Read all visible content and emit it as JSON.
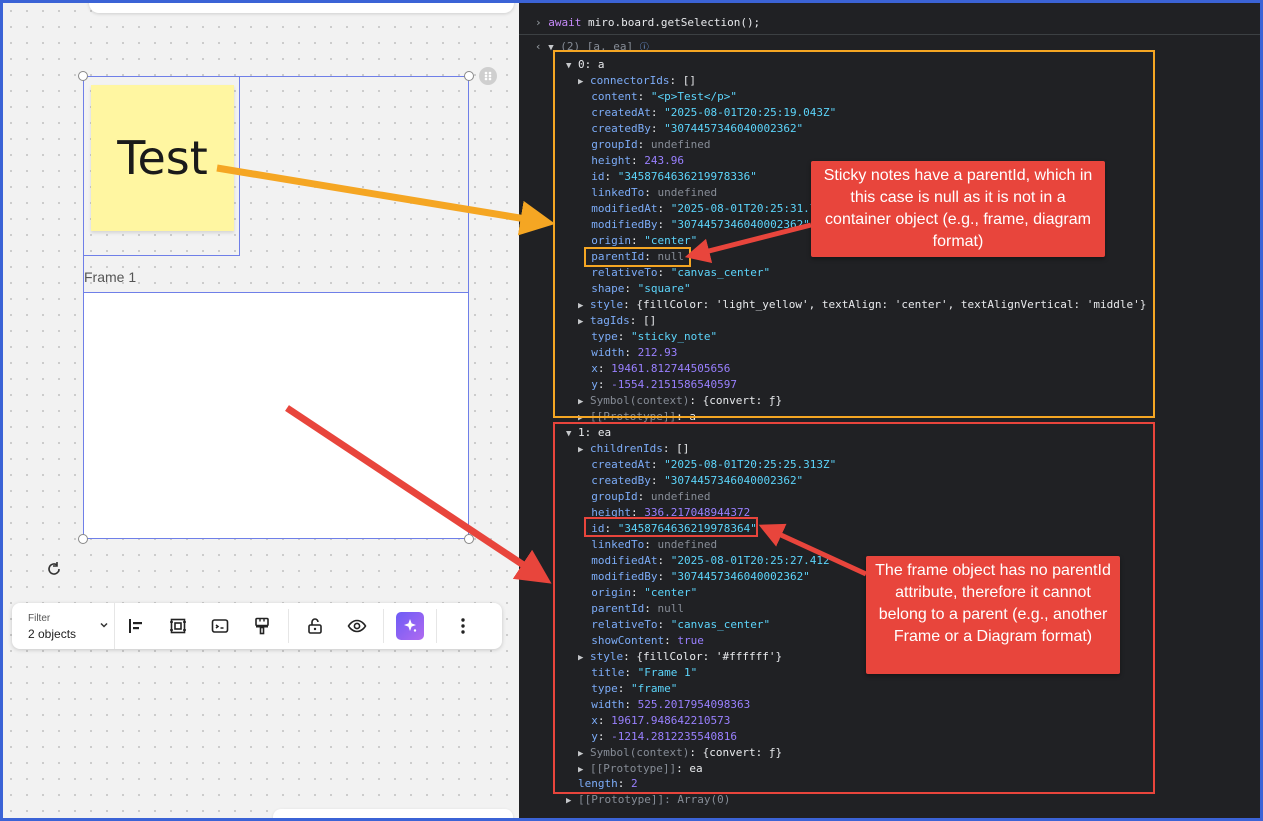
{
  "canvas": {
    "sticky_text": "Test",
    "frame_label": "Frame 1",
    "toolbar": {
      "filter_label": "Filter",
      "filter_value": "2 objects",
      "tools": [
        "align-icon",
        "frame-icon",
        "present-icon",
        "format-painter-icon",
        "unlock-icon",
        "eye-icon",
        "ai-sparkle-icon",
        "more-icon"
      ]
    }
  },
  "console": {
    "command_await": "await",
    "command_rest": " miro.board.getSelection();",
    "result_summary": "(2) [a, ea]",
    "item0": {
      "header": "0: a",
      "lines": [
        [
          "connectorIds",
          "[]"
        ],
        [
          "content",
          "\"<p>Test</p>\""
        ],
        [
          "createdAt",
          "\"2025-08-01T20:25:19.043Z\""
        ],
        [
          "createdBy",
          "\"3074457346040002362\""
        ],
        [
          "groupId",
          "undefined"
        ],
        [
          "height",
          "243.96"
        ],
        [
          "id",
          "\"3458764636219978336\""
        ],
        [
          "linkedTo",
          "undefined"
        ],
        [
          "modifiedAt",
          "\"2025-08-01T20:25:31.7"
        ],
        [
          "modifiedBy",
          "\"3074457346040002362\""
        ],
        [
          "origin",
          "\"center\""
        ],
        [
          "parentId",
          "null"
        ],
        [
          "relativeTo",
          "\"canvas_center\""
        ],
        [
          "shape",
          "\"square\""
        ],
        [
          "style",
          "{fillColor: 'light_yellow', textAlign: 'center', textAlignVertical: 'middle'}"
        ],
        [
          "tagIds",
          "[]"
        ],
        [
          "type",
          "\"sticky_note\""
        ],
        [
          "width",
          "212.93"
        ],
        [
          "x",
          "19461.812744505656"
        ],
        [
          "y",
          "-1554.2151586540597"
        ],
        [
          "Symbol(context)",
          "{convert: ƒ}"
        ],
        [
          "[[Prototype]]",
          "a"
        ]
      ]
    },
    "item1": {
      "header": "1: ea",
      "lines": [
        [
          "childrenIds",
          "[]"
        ],
        [
          "createdAt",
          "\"2025-08-01T20:25:25.313Z\""
        ],
        [
          "createdBy",
          "\"3074457346040002362\""
        ],
        [
          "groupId",
          "undefined"
        ],
        [
          "height",
          "336.217048944372"
        ],
        [
          "id",
          "\"3458764636219978364\""
        ],
        [
          "linkedTo",
          "undefined"
        ],
        [
          "modifiedAt",
          "\"2025-08-01T20:25:27.412"
        ],
        [
          "modifiedBy",
          "\"3074457346040002362\""
        ],
        [
          "origin",
          "\"center\""
        ],
        [
          "parentId",
          "null"
        ],
        [
          "relativeTo",
          "\"canvas_center\""
        ],
        [
          "showContent",
          "true"
        ],
        [
          "style",
          "{fillColor: '#ffffff'}"
        ],
        [
          "title",
          "\"Frame 1\""
        ],
        [
          "type",
          "\"frame\""
        ],
        [
          "width",
          "525.2017954098363"
        ],
        [
          "x",
          "19617.948642210573"
        ],
        [
          "y",
          "-1214.2812235540816"
        ],
        [
          "Symbol(context)",
          "{convert: ƒ}"
        ],
        [
          "[[Prototype]]",
          "ea"
        ]
      ]
    },
    "length_label": "length",
    "length_value": "2",
    "array_proto": "[[Prototype]]: Array(0)"
  },
  "callouts": {
    "sticky": "Sticky notes have a parentId, which in this case is null as it is not in a container object (e.g., frame,  diagram format)",
    "frame": "The frame object has no parentId attribute, therefore it cannot belong to a parent (e.g., another Frame or a Diagram format)"
  },
  "colors": {
    "accent_blue": "#3b63d6",
    "orange": "#f5a623",
    "red": "#e8453c",
    "sticky_yellow": "#fff6a1",
    "console_bg": "#202124"
  }
}
